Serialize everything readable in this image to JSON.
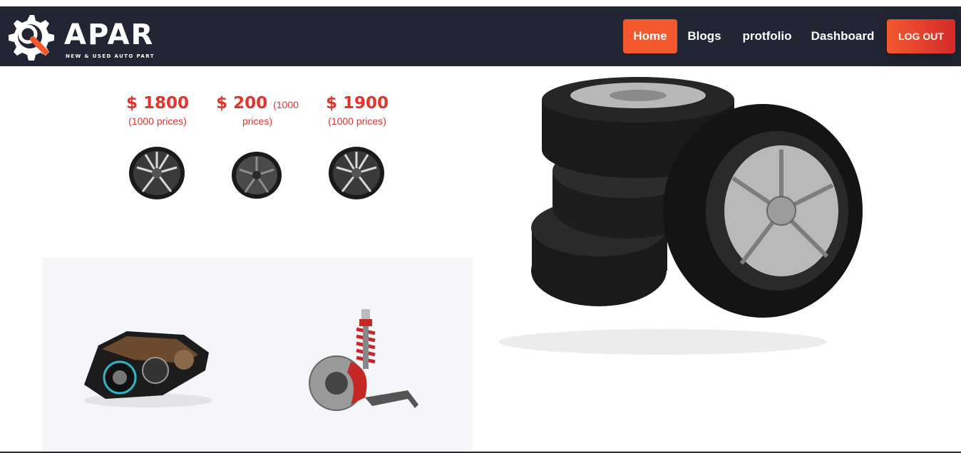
{
  "brand": {
    "name": "APAR",
    "tagline": "NEW & USED AUTO PART"
  },
  "nav": {
    "items": [
      {
        "label": "Home",
        "active": true
      },
      {
        "label": "Blogs"
      },
      {
        "label": "protfolio"
      },
      {
        "label": "Dashboard"
      }
    ],
    "logout_label": "LOG OUT"
  },
  "prices": [
    {
      "amount": "$ 1800",
      "note": "(1000 prices)"
    },
    {
      "amount": "$ 200",
      "note_inline": "(1000",
      "note": "prices)"
    },
    {
      "amount": "$ 1900",
      "note": "(1000 prices)"
    }
  ],
  "colors": {
    "navbar": "#222533",
    "accent": "#f4582f",
    "price": "#e8312b",
    "panel": "#f5f6fa"
  },
  "icons": [
    "gear-wrench-logo-icon"
  ]
}
